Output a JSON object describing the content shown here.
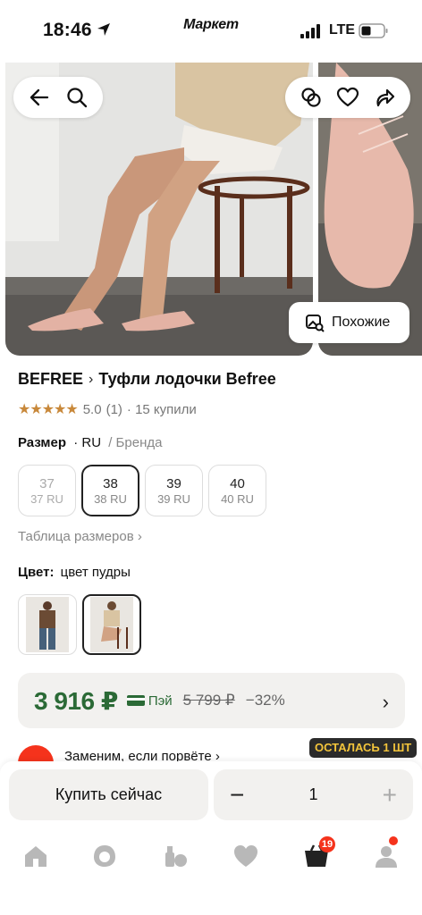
{
  "status_bar": {
    "time": "18:46",
    "brand": "Маркет",
    "network": "LTE"
  },
  "gallery": {
    "similar_label": "Похожие"
  },
  "product": {
    "brand": "BEFREE",
    "name": "Туфли лодочки Befree",
    "rating": "5.0",
    "reviews": "(1)",
    "bought": "· 15 купили"
  },
  "sizes": {
    "label": "Размер",
    "system": "· RU",
    "brand_system": "/ Бренда",
    "items": [
      {
        "main": "37",
        "sub": "37 RU",
        "state": "disabled"
      },
      {
        "main": "38",
        "sub": "38 RU",
        "state": "selected"
      },
      {
        "main": "39",
        "sub": "39 RU",
        "state": "available"
      },
      {
        "main": "40",
        "sub": "40 RU",
        "state": "available"
      }
    ],
    "table_link": "Таблица размеров ›"
  },
  "color": {
    "label": "Цвет:",
    "value": "цвет пудры",
    "selected_index": 1
  },
  "price": {
    "current": "3 916 ₽",
    "pay_label": "Пэй",
    "old": "5 799 ₽",
    "discount": "−32%"
  },
  "promo": {
    "text": "Заменим, если порвёте ›",
    "stock": "ОСТАЛАСЬ 1 ШТ"
  },
  "buy": {
    "button": "Купить сейчас",
    "quantity": "1",
    "minus": "−",
    "plus": "+"
  },
  "tabbar": {
    "items": [
      "home-icon",
      "discovery-icon",
      "catalog-icon",
      "favorites-icon",
      "cart-icon",
      "profile-icon"
    ],
    "cart_count": "19"
  },
  "colors": {
    "price_green": "#2b6a36",
    "badge_red": "#f5331c",
    "stock_yellow": "#f3c43b"
  }
}
